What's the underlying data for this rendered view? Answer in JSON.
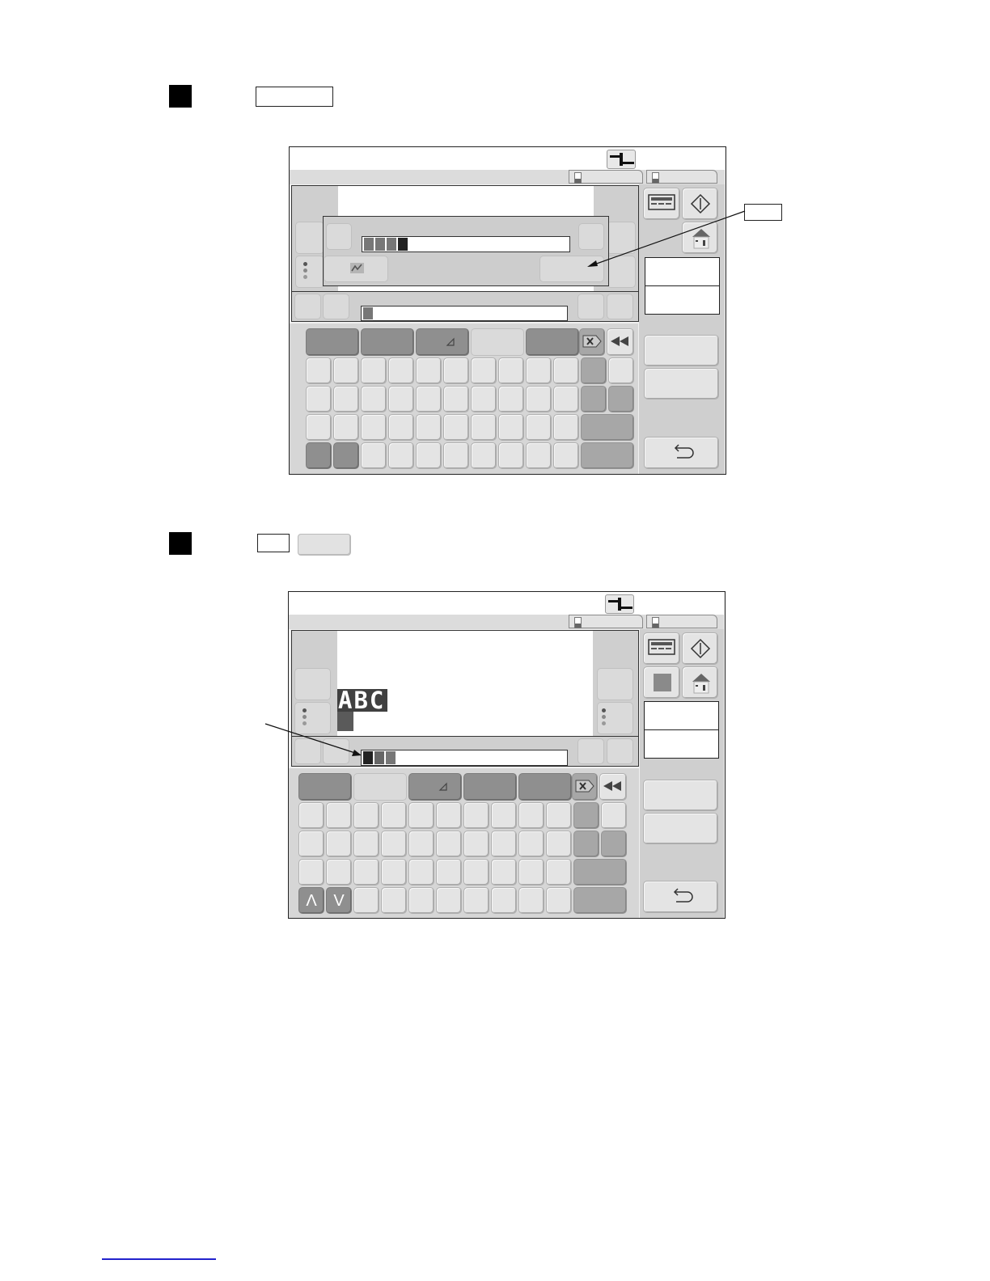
{
  "instructions": {
    "step_a": {
      "key_label": ""
    },
    "step_b": {
      "key1_label": "",
      "key2_label": ""
    },
    "callout_a": "",
    "callout_b": ""
  },
  "screen_a": {
    "title": "",
    "tab1_label": "",
    "tab2_label": "",
    "message_text": "",
    "popup_value": "",
    "popup_button": "",
    "info_box1": "",
    "info_box2": "",
    "side_button1": "",
    "side_button2": "",
    "back_icon": "undo-arrow-icon",
    "field1_cells": [
      "#777777",
      "#777777",
      "#777777",
      "#222222"
    ],
    "field2_cells": [
      "#777777"
    ],
    "keys": []
  },
  "screen_b": {
    "title": "",
    "tab1_label": "",
    "tab2_label": "",
    "display_text": "ABC",
    "info_box1": "",
    "info_box2": "",
    "side_button1": "",
    "side_button2": "",
    "back_icon": "undo-arrow-icon",
    "field_cells": [
      "#222222",
      "#666666",
      "#777777"
    ],
    "up_key": "Λ",
    "down_key": "V",
    "keys": []
  },
  "colors": {
    "dark_key": "#8f8f8f",
    "mid_key": "#a7a7a7",
    "light_key": "#e4e4e4",
    "panel": "#c9c9c9"
  }
}
